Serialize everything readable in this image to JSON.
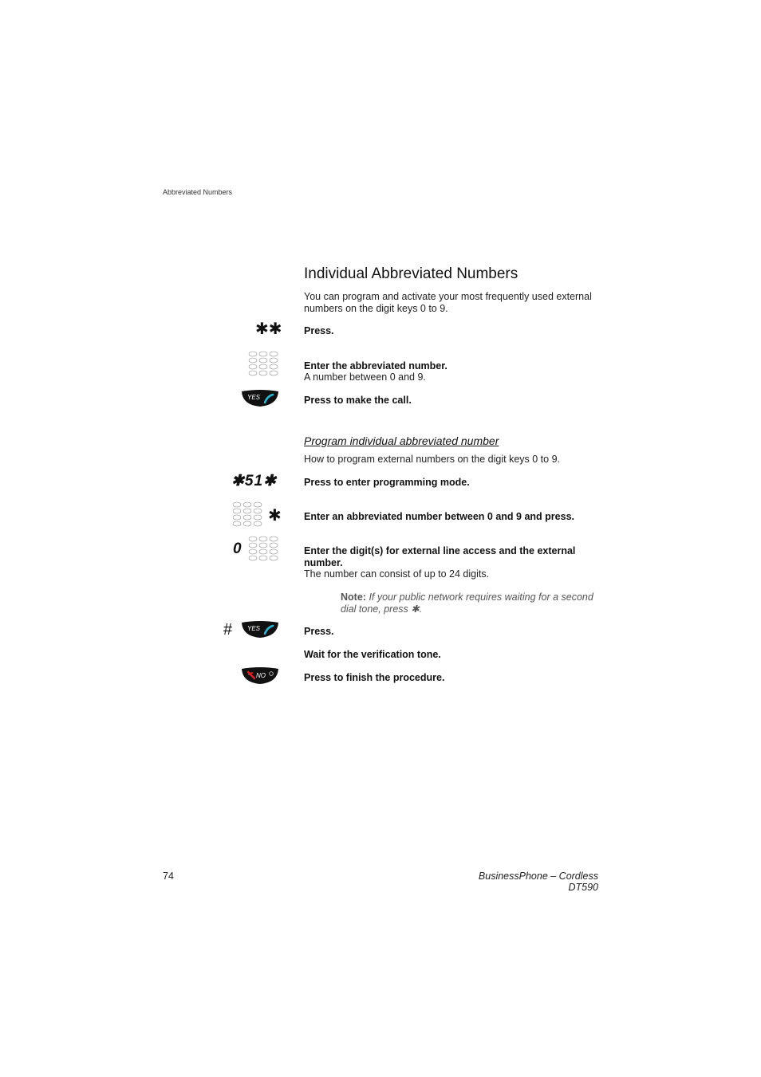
{
  "header": {
    "section": "Abbreviated Numbers"
  },
  "title": "Individual Abbreviated Numbers",
  "intro": "You can program and activate your most frequently used external numbers on the digit keys 0 to 9.",
  "steps_call": [
    {
      "icon": "star-star",
      "icon_text": "✱✱",
      "instruction": "Press.",
      "detail": ""
    },
    {
      "icon": "keypad",
      "instruction": "Enter the abbreviated number.",
      "detail": "A number between 0 and 9."
    },
    {
      "icon": "yes-key",
      "key_label": "YES",
      "instruction": "Press to make the call.",
      "detail": ""
    }
  ],
  "subsection": {
    "title": "Program individual abbreviated number",
    "intro": "How to program external numbers on the digit keys 0 to 9.",
    "steps": [
      {
        "icon": "code-star-51-star",
        "icon_text": "✱51✱",
        "instruction": "Press to enter programming mode."
      },
      {
        "icon": "keypad-star",
        "icon_text": "✱",
        "instruction": "Enter an abbreviated number between 0 and 9 and press."
      },
      {
        "icon": "zero-keypad",
        "icon_text": "0",
        "instruction": "Enter the digit(s) for external line access and the external number.",
        "detail": "The number can consist of up to 24 digits."
      },
      {
        "icon": "hash-yes-key",
        "icon_text": "#",
        "key_label": "YES",
        "instruction": "Press."
      },
      {
        "icon": "none",
        "instruction": "Wait for the verification tone."
      },
      {
        "icon": "no-key",
        "key_label": "NO",
        "instruction": "Press to finish the procedure."
      }
    ],
    "note": {
      "label": "Note:",
      "text": "If your public network requires waiting for a second dial tone, press ✱."
    }
  },
  "footer": {
    "page_number": "74",
    "product": "BusinessPhone – Cordless DT590"
  },
  "colors": {
    "key_bg": "#111111",
    "yes_handset": "#2ab7d6",
    "no_handset": "#e02020"
  }
}
